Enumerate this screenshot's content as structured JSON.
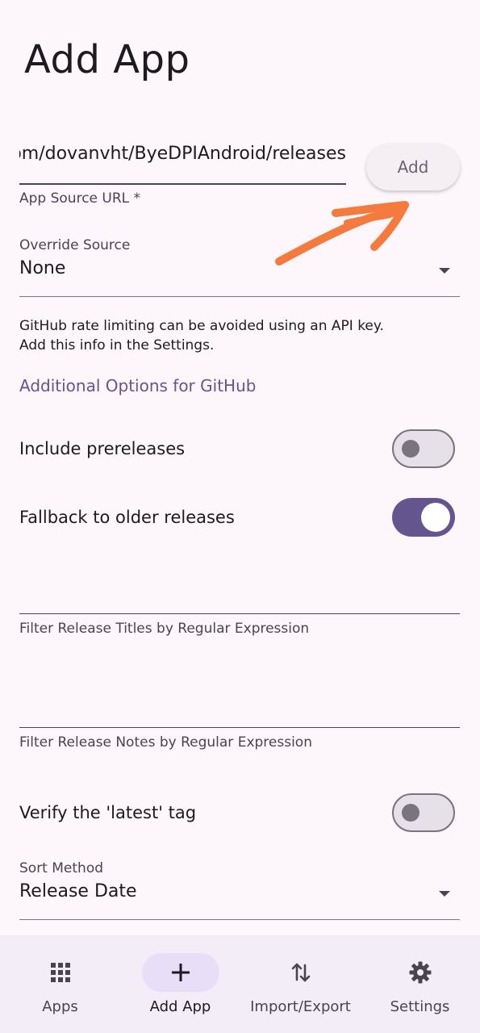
{
  "page": {
    "title": "Add App"
  },
  "source": {
    "url_value": "https://github.com/dovanvht/ByeDPIAndroid/releases",
    "url_label": "App Source URL *",
    "add_label": "Add"
  },
  "override": {
    "label": "Override Source",
    "value": "None"
  },
  "info": {
    "line1": "GitHub rate limiting can be avoided using an API key.",
    "line2": "Add this info in the Settings."
  },
  "github": {
    "section_title": "Additional Options for GitHub",
    "include_prereleases": {
      "label": "Include prereleases",
      "on": false
    },
    "fallback_older": {
      "label": "Fallback to older releases",
      "on": true
    },
    "filter_titles_label": "Filter Release Titles by Regular Expression",
    "filter_notes_label": "Filter Release Notes by Regular Expression",
    "verify_latest": {
      "label": "Verify the 'latest' tag",
      "on": false
    }
  },
  "sort": {
    "label": "Sort Method",
    "value": "Release Date"
  },
  "nav": {
    "items": [
      {
        "label": "Apps",
        "icon": "grid-icon",
        "active": false
      },
      {
        "label": "Add App",
        "icon": "plus-icon",
        "active": true
      },
      {
        "label": "Import/Export",
        "icon": "swap-vertical-icon",
        "active": false
      },
      {
        "label": "Settings",
        "icon": "gear-icon",
        "active": false
      }
    ]
  },
  "colors": {
    "background": "#fdf7fb",
    "accent": "#65558f",
    "arrow_annotation": "#f47a3e",
    "nav_background": "#f3edf7",
    "active_pill": "#e8def8"
  }
}
